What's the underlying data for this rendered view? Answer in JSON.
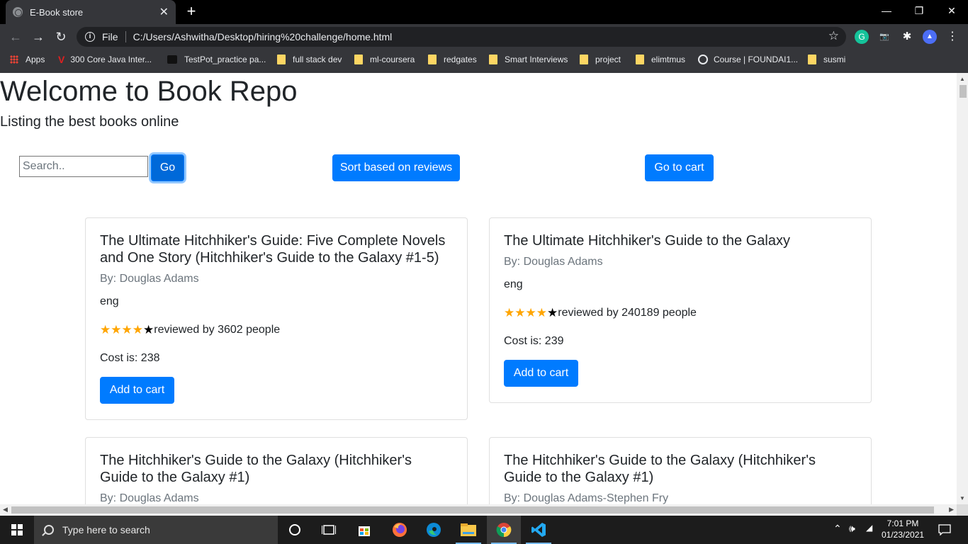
{
  "browser": {
    "tab_title": "E-Book store",
    "tab_close": "✕",
    "new_tab": "+",
    "window_controls": {
      "minimize": "—",
      "restore": "❐",
      "close": "✕"
    },
    "nav": {
      "back": "←",
      "forward": "→",
      "reload": "↻"
    },
    "address": {
      "scheme": "File",
      "url": "C:/Users/Ashwitha/Desktop/hiring%20challenge/home.html",
      "star": "☆"
    },
    "extensions": [
      "G",
      "📷",
      "✱",
      "▲",
      "⋮"
    ],
    "bookmarks": [
      {
        "label": "Apps",
        "icon": "apps-grid-icon"
      },
      {
        "label": "300 Core Java Inter...",
        "icon": "v-logo-icon"
      },
      {
        "label": "TestPot_practice pa...",
        "icon": "cup-icon"
      },
      {
        "label": "full stack dev",
        "icon": "folder-icon"
      },
      {
        "label": "ml-coursera",
        "icon": "folder-icon"
      },
      {
        "label": "redgates",
        "icon": "folder-icon"
      },
      {
        "label": "Smart Interviews",
        "icon": "folder-icon"
      },
      {
        "label": "project",
        "icon": "folder-icon"
      },
      {
        "label": "elimtmus",
        "icon": "folder-icon"
      },
      {
        "label": "Course | FOUNDAI1...",
        "icon": "globe-icon"
      },
      {
        "label": "susmi",
        "icon": "folder-icon"
      }
    ]
  },
  "page": {
    "title": "Welcome to Book Repo",
    "subtitle": "Listing the best books online",
    "search_placeholder": "Search..",
    "search_value": "",
    "go_label": "Go",
    "sort_label": "Sort based on reviews",
    "cart_label": "Go to cart",
    "books": [
      {
        "title": "The Ultimate Hitchhiker's Guide: Five Complete Novels and One Story (Hitchhiker's Guide to the Galaxy #1-5)",
        "author": "By: Douglas Adams",
        "language": "eng",
        "stars_filled": 4,
        "stars_total": 5,
        "reviews": "reviewed by 3602 people",
        "cost": "Cost is: 238",
        "add_label": "Add to cart"
      },
      {
        "title": "The Ultimate Hitchhiker's Guide to the Galaxy",
        "author": "By: Douglas Adams",
        "language": "eng",
        "stars_filled": 4,
        "stars_total": 5,
        "reviews": "reviewed by 240189 people",
        "cost": "Cost is: 239",
        "add_label": "Add to cart"
      },
      {
        "title": "The Hitchhiker's Guide to the Galaxy (Hitchhiker's Guide to the Galaxy #1)",
        "author": "By: Douglas Adams"
      },
      {
        "title": "The Hitchhiker's Guide to the Galaxy (Hitchhiker's Guide to the Galaxy #1)",
        "author": "By: Douglas Adams-Stephen Fry"
      }
    ]
  },
  "taskbar": {
    "search_placeholder": "Type here to search",
    "time": "7:01 PM",
    "date": "01/23/2021",
    "apps": [
      "task-view",
      "file-manager",
      "store",
      "firefox",
      "edge",
      "file-explorer",
      "chrome",
      "vscode"
    ]
  },
  "colors": {
    "primary": "#007bff",
    "star": "#ffa500",
    "chrome_dark": "#35363a"
  }
}
